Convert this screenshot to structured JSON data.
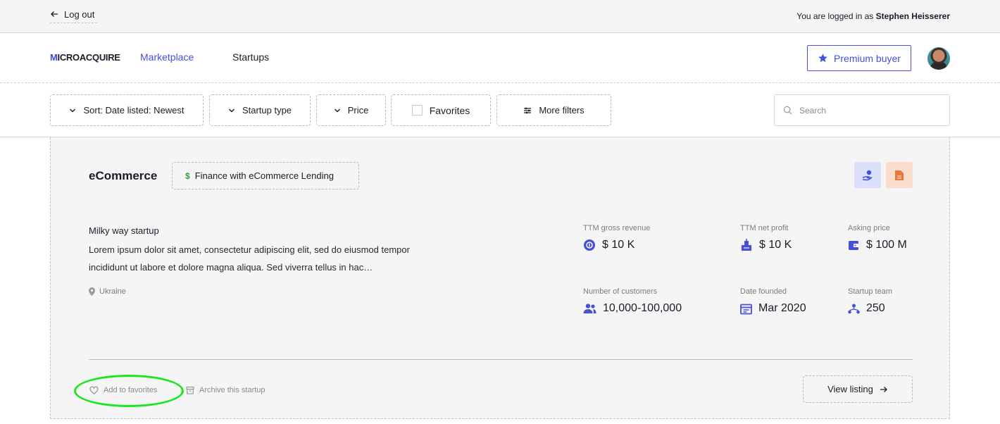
{
  "header": {
    "logout_label": "Log out",
    "logged_in_prefix": "You are logged in as ",
    "user_name": "Stephen Heisserer"
  },
  "nav": {
    "logo_text": "ICROACQUIRE",
    "logo_initial": "M",
    "links": [
      {
        "label": "Marketplace",
        "active": true
      },
      {
        "label": "Startups",
        "active": false
      }
    ],
    "premium_label": "Premium buyer"
  },
  "filters": {
    "sort_label": "Sort: Date listed: Newest",
    "startup_type_label": "Startup type",
    "price_label": "Price",
    "favorites_label": "Favorites",
    "favorites_checked": false,
    "more_filters_label": "More filters",
    "search_placeholder": "Search"
  },
  "listing": {
    "category": "eCommerce",
    "finance_tag": "Finance with eCommerce Lending",
    "finance_tag_symbol": "$",
    "name": "Milky way startup",
    "description": "Lorem ipsum dolor sit amet, consectetur adipiscing elit, sed do eiusmod tempor incididunt ut labore et dolore magna aliqua. Sed viverra tellus in hac…",
    "location": "Ukraine",
    "metrics": {
      "gross_revenue": {
        "label": "TTM gross revenue",
        "value": "$ 10 K"
      },
      "net_profit": {
        "label": "TTM net profit",
        "value": "$ 10 K"
      },
      "asking_price": {
        "label": "Asking price",
        "value": "$ 100 M"
      },
      "customers": {
        "label": "Number of customers",
        "value": "10,000-100,000"
      },
      "date_founded": {
        "label": "Date founded",
        "value": "Mar 2020"
      },
      "team": {
        "label": "Startup team",
        "value": "250"
      }
    },
    "add_favorites_label": "Add to favorites",
    "archive_label": "Archive this startup",
    "view_listing_label": "View listing"
  },
  "colors": {
    "accent": "#4451d8",
    "highlight_ellipse": "#1ee61e",
    "finance_dollar": "#2ea043",
    "card_bg": "#f5f5f5"
  }
}
